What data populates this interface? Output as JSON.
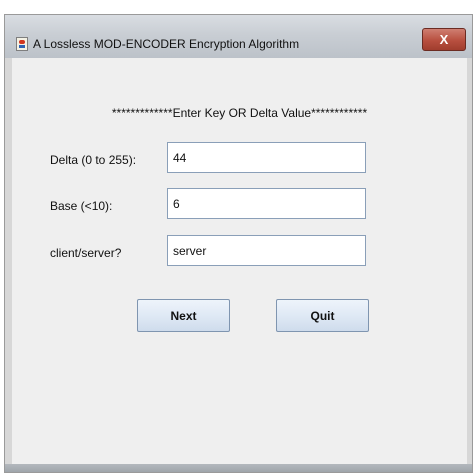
{
  "window": {
    "title": "A Lossless MOD-ENCODER Encryption Algorithm",
    "close_label": "X"
  },
  "form": {
    "heading": "*************Enter Key OR Delta Value************",
    "delta_label": "Delta (0 to 255):",
    "delta_value": "44",
    "base_label": "Base (<10):",
    "base_value": "6",
    "mode_label": "client/server?",
    "mode_value": "server"
  },
  "buttons": {
    "next": "Next",
    "quit": "Quit"
  },
  "colors": {
    "content_background": "#efefef",
    "close_button": "#b84f3f",
    "field_border": "#8a9fb8"
  }
}
